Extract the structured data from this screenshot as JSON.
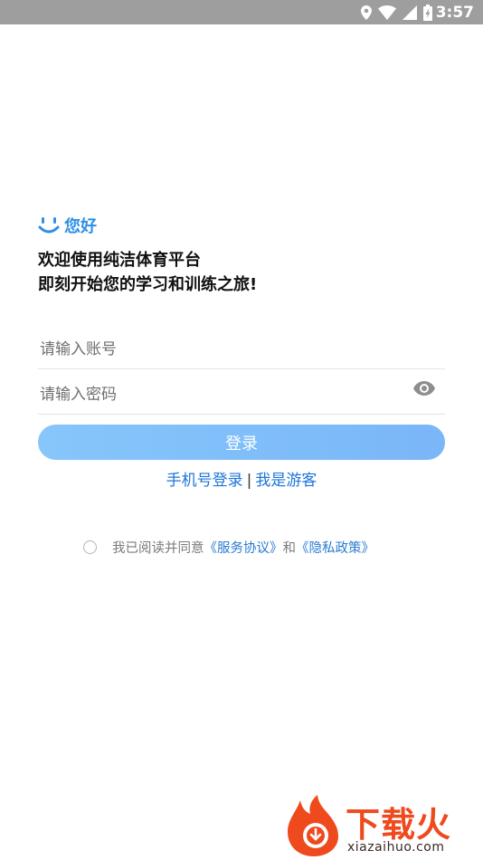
{
  "status_bar": {
    "time": "3:57",
    "icons": [
      "location-icon",
      "wifi-icon",
      "signal-icon",
      "battery-icon"
    ]
  },
  "greeting": {
    "icon": "smile-icon",
    "text": "您好"
  },
  "welcome": {
    "line1": "欢迎使用纯洁体育平台",
    "line2": "即刻开始您的学习和训练之旅!"
  },
  "form": {
    "account_placeholder": "请输入账号",
    "password_placeholder": "请输入密码",
    "account_value": "",
    "password_value": "",
    "login_label": "登录"
  },
  "alt_links": {
    "phone_login": "手机号登录",
    "separator": "|",
    "guest": "我是游客"
  },
  "agreement": {
    "prefix": "我已阅读并同意",
    "service_link": "《服务协议》",
    "conjunction": "和",
    "privacy_link": "《隐私政策》"
  },
  "watermark": {
    "name": "下载火",
    "url": "xiazaihuo.com"
  },
  "colors": {
    "status_bar": "#9e9e9e",
    "accent": "#2f8fe6",
    "login_button": "#7ab6f8",
    "link": "#1c75d8",
    "watermark": "#ef4a1e"
  }
}
